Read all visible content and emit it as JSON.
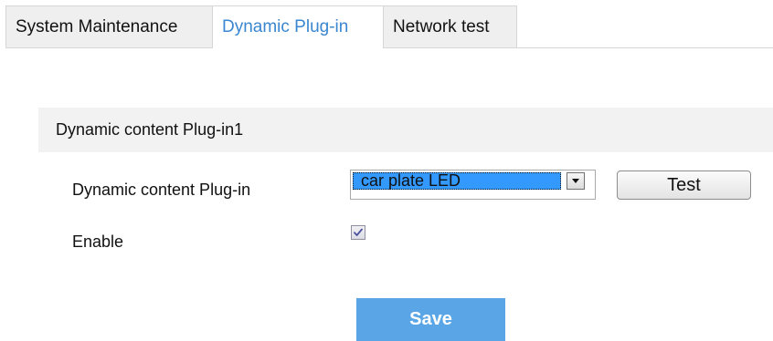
{
  "tabs": {
    "system_maintenance": "System Maintenance",
    "dynamic_plugin": "Dynamic Plug-in",
    "network_test": "Network test",
    "active": "dynamic_plugin"
  },
  "section": {
    "title": "Dynamic content Plug-in1"
  },
  "form": {
    "plugin_label": "Dynamic content Plug-in",
    "plugin_selected": "car plate LED",
    "test_button": "Test",
    "enable_label": "Enable",
    "enable_checked": true
  },
  "actions": {
    "save": "Save"
  },
  "colors": {
    "active_tab_text": "#3a86d0",
    "select_highlight": "#3399ff",
    "save_button": "#5aa5e6"
  }
}
